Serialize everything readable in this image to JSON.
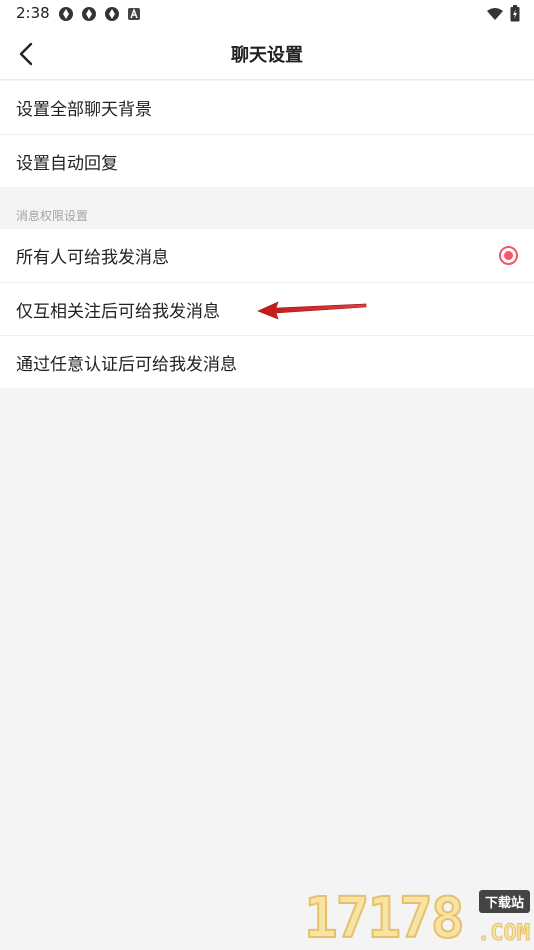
{
  "status_bar": {
    "time": "2:38",
    "left_icons": [
      "notification-icon",
      "notification-icon",
      "notification-icon",
      "a-badge-icon"
    ],
    "right_icons": [
      "wifi-icon",
      "battery-icon"
    ]
  },
  "header": {
    "title": "聊天设置",
    "back_icon": "chevron-left-icon"
  },
  "settings": {
    "items": [
      {
        "label": "设置全部聊天背景"
      },
      {
        "label": "设置自动回复"
      }
    ]
  },
  "permissions": {
    "section_title": "消息权限设置",
    "options": [
      {
        "label": "所有人可给我发消息",
        "selected": true
      },
      {
        "label": "仅互相关注后可给我发消息",
        "selected": false
      },
      {
        "label": "通过任意认证后可给我发消息",
        "selected": false
      }
    ]
  },
  "annotation": {
    "type": "red-arrow",
    "color": "#d42a2a",
    "points_to": "仅互相关注后可给我发消息"
  },
  "watermark": {
    "digits": "17178",
    "badge": "下载站",
    "suffix": ".COM"
  },
  "colors": {
    "accent": "#f2566a",
    "background": "#f4f4f4"
  }
}
